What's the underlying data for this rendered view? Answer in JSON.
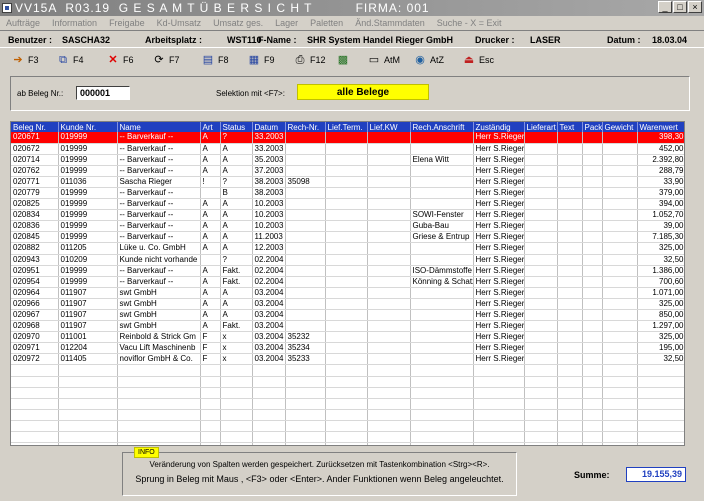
{
  "window": {
    "title": "VV15A  R03.19  G E S A M T Ü B E R S I C H T          FIRMA: 001",
    "btn_min": "_",
    "btn_max": "□",
    "btn_close": "×"
  },
  "menu": {
    "items": [
      "Aufträge",
      "Information",
      "Freigabe",
      "Kd-Umsatz",
      "Umsatz ges.",
      "Lager",
      "Paletten",
      "Änd.Stammdaten",
      "Suche - X = Exit"
    ]
  },
  "infoline": {
    "benutzer_label": "Benutzer :",
    "benutzer": "SASCHA32",
    "arbeitsplatz_label": "Arbeitsplatz :",
    "arbeitsplatz": "WST110",
    "fname_label": "F-Name :",
    "fname": "SHR System Handel Rieger GmbH",
    "drucker_label": "Drucker :",
    "drucker": "LASER",
    "datum_label": "Datum :",
    "datum": "18.03.04"
  },
  "toolbar": {
    "f3": "F3",
    "f4": "F4",
    "f6": "F6",
    "f7": "F7",
    "f8": "F8",
    "f9": "F9",
    "f12": "F12",
    "atm": "AtM",
    "atz": "AtZ",
    "esc": "Esc"
  },
  "selection": {
    "beleg_label": "ab Beleg Nr.:",
    "beleg_value": "000001",
    "sel_label": "Selektion mit <F7>:",
    "sel_value": "alle Belege"
  },
  "grid": {
    "columns": [
      "Beleg Nr.",
      "Kunde Nr.",
      "Name",
      "Art",
      "Status",
      "Datum",
      "Rech-Nr.",
      "Lief.Term.",
      "Lief.KW",
      "Rech.Anschrift",
      "Zuständig",
      "Lieferart",
      "Text",
      "Pack",
      "Gewicht",
      "Warenwert"
    ],
    "rows": [
      [
        "020671",
        "019999",
        "-- Barverkauf --",
        "A",
        "?",
        "33.2003",
        "",
        "",
        "",
        "",
        "Herr S.Rieger",
        "",
        "",
        "",
        "",
        "398,30"
      ],
      [
        "020672",
        "019999",
        "-- Barverkauf --",
        "A",
        "A",
        "33.2003",
        "",
        "",
        "",
        "",
        "Herr S.Rieger",
        "",
        "",
        "",
        "",
        "452,00"
      ],
      [
        "020714",
        "019999",
        "-- Barverkauf --",
        "A",
        "A",
        "35.2003",
        "",
        "",
        "",
        "Elena Witt",
        "Herr S.Rieger",
        "",
        "",
        "",
        "",
        "2.392,80"
      ],
      [
        "020762",
        "019999",
        "-- Barverkauf --",
        "A",
        "A",
        "37.2003",
        "",
        "",
        "",
        "",
        "Herr S.Rieger",
        "",
        "",
        "",
        "",
        "288,79"
      ],
      [
        "020771",
        "011036",
        "Sascha Rieger",
        "!",
        "?",
        "38.2003",
        "35098",
        "",
        "",
        "",
        "Herr S.Rieger",
        "",
        "",
        "",
        "",
        "33,90"
      ],
      [
        "020779",
        "019999",
        "-- Barverkauf --",
        "",
        "B",
        "38.2003",
        "",
        "",
        "",
        "",
        "Herr S.Rieger",
        "",
        "",
        "",
        "",
        "379,00"
      ],
      [
        "020825",
        "019999",
        "-- Barverkauf --",
        "A",
        "A",
        "10.2003",
        "",
        "",
        "",
        "",
        "Herr S.Rieger",
        "",
        "",
        "",
        "",
        "394,00"
      ],
      [
        "020834",
        "019999",
        "-- Barverkauf --",
        "A",
        "A",
        "10.2003",
        "",
        "",
        "",
        "SOWI-Fenster",
        "Herr S.Rieger",
        "",
        "",
        "",
        "",
        "1.052,70"
      ],
      [
        "020836",
        "019999",
        "-- Barverkauf --",
        "A",
        "A",
        "10.2003",
        "",
        "",
        "",
        "Guba-Bau",
        "Herr S.Rieger",
        "",
        "",
        "",
        "",
        "39,00"
      ],
      [
        "020845",
        "019999",
        "-- Barverkauf --",
        "A",
        "A",
        "11.2003",
        "",
        "",
        "",
        "Griese & Entrup",
        "Herr S.Rieger",
        "",
        "",
        "",
        "",
        "7.185,30"
      ],
      [
        "020882",
        "011205",
        "Lüke u. Co. GmbH",
        "A",
        "A",
        "12.2003",
        "",
        "",
        "",
        "",
        "Herr S.Rieger",
        "",
        "",
        "",
        "",
        "325,00"
      ],
      [
        "020943",
        "010209",
        "Kunde nicht vorhande",
        "",
        "?",
        "02.2004",
        "",
        "",
        "",
        "",
        "Herr S.Rieger",
        "",
        "",
        "",
        "",
        "32,50"
      ],
      [
        "020951",
        "019999",
        "-- Barverkauf --",
        "A",
        "Fakt.",
        "02.2004",
        "",
        "",
        "",
        "ISO-Dämmstoffe",
        "Herr S.Rieger",
        "",
        "",
        "",
        "",
        "1.386,00"
      ],
      [
        "020954",
        "019999",
        "-- Barverkauf --",
        "A",
        "Fakt.",
        "02.2004",
        "",
        "",
        "",
        "Könning & Schatz",
        "Herr S.Rieger",
        "",
        "",
        "",
        "",
        "700,60"
      ],
      [
        "020964",
        "011907",
        "swt GmbH",
        "A",
        "A",
        "03.2004",
        "",
        "",
        "",
        "",
        "Herr S.Rieger",
        "",
        "",
        "",
        "",
        "1.071,00"
      ],
      [
        "020966",
        "011907",
        "swt GmbH",
        "A",
        "A",
        "03.2004",
        "",
        "",
        "",
        "",
        "Herr S.Rieger",
        "",
        "",
        "",
        "",
        "325,00"
      ],
      [
        "020967",
        "011907",
        "swt GmbH",
        "A",
        "A",
        "03.2004",
        "",
        "",
        "",
        "",
        "Herr S.Rieger",
        "",
        "",
        "",
        "",
        "850,00"
      ],
      [
        "020968",
        "011907",
        "swt GmbH",
        "A",
        "Fakt.",
        "03.2004",
        "",
        "",
        "",
        "",
        "Herr S.Rieger",
        "",
        "",
        "",
        "",
        "1.297,00"
      ],
      [
        "020970",
        "011001",
        "Reinbold & Strick Gm",
        "F",
        "x",
        "03.2004",
        "35232",
        "",
        "",
        "",
        "Herr S.Rieger",
        "",
        "",
        "",
        "",
        "325,00"
      ],
      [
        "020971",
        "012204",
        "Vacu Lift Maschinenb",
        "F",
        "x",
        "03.2004",
        "35234",
        "",
        "",
        "",
        "Herr S.Rieger",
        "",
        "",
        "",
        "",
        "195,00"
      ],
      [
        "020972",
        "011405",
        "noviflor GmbH & Co.",
        "F",
        "x",
        "03.2004",
        "35233",
        "",
        "",
        "",
        "Herr S.Rieger",
        "",
        "",
        "",
        "",
        "32,50"
      ]
    ]
  },
  "info": {
    "tag": "INFO",
    "line1": "Veränderung von Spalten werden gespeichert. Zurücksetzen mit Tastenkombination <Strg><R>.",
    "line2": "Sprung in Beleg mit Maus , <F3> oder <Enter>.  Ander Funktionen wenn Beleg angeleuchtet."
  },
  "summe": {
    "label": "Summe:",
    "value": "19.155,39"
  },
  "colors": {
    "header_blue": "#2040c0",
    "selected_row": "#ff0000",
    "highlight_yellow": "#ffff00"
  }
}
